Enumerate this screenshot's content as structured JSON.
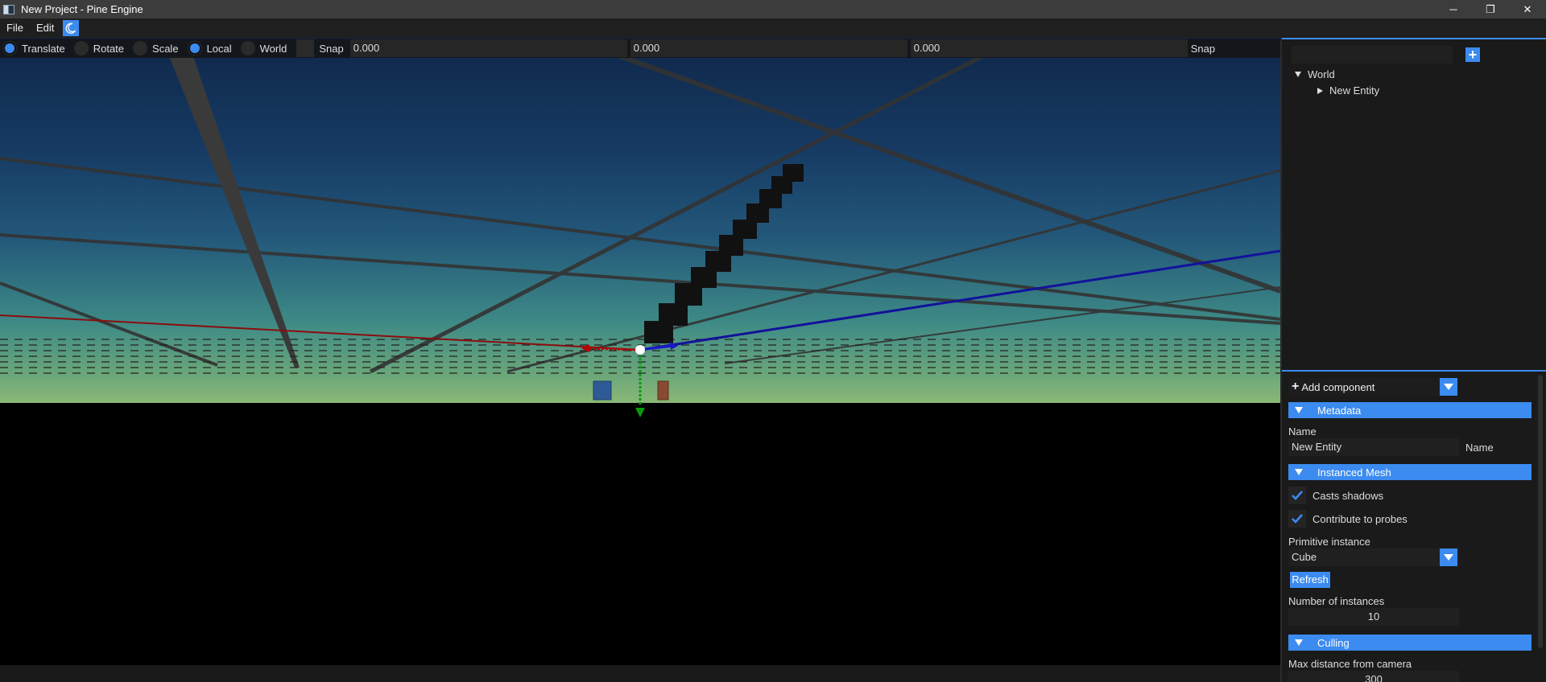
{
  "window": {
    "title": "New Project - Pine Engine",
    "minimize_glyph": "─",
    "maximize_glyph": "❐",
    "close_glyph": "✕"
  },
  "menu": {
    "items": [
      "File",
      "Edit"
    ],
    "theme_icon": "moon-icon"
  },
  "gizmo_toolbar": {
    "translate": "Translate",
    "rotate": "Rotate",
    "scale": "Scale",
    "local": "Local",
    "world": "World",
    "snap_label": "Snap",
    "snap_x": "0.000",
    "snap_y": "0.000",
    "snap_z": "0.000",
    "snap_label_2": "Snap",
    "selected_mode": "Translate",
    "selected_space": "Local"
  },
  "outliner": {
    "search_value": "",
    "add_icon": "plus-icon",
    "tree": [
      {
        "label": "World",
        "expanded": true
      },
      {
        "label": "New Entity",
        "expanded": false
      }
    ]
  },
  "inspector": {
    "add_component": "Add component",
    "metadata_header": "Metadata",
    "name_label": "Name",
    "name_value": "New Entity",
    "name_suffix": "Name",
    "instanced_mesh_header": "Instanced Mesh",
    "casts_shadows": "Casts shadows",
    "casts_shadows_checked": true,
    "contribute_probes": "Contribute to probes",
    "contribute_probes_checked": true,
    "primitive_label": "Primitive instance",
    "primitive_value": "Cube",
    "refresh": "Refresh",
    "instances_label": "Number of instances",
    "instances_value": "10",
    "culling_header": "Culling",
    "max_distance_label": "Max distance from camera",
    "max_distance_value": "300"
  },
  "colors": {
    "accent": "#3b8bf0",
    "panel": "#1a1a1a",
    "axis_x": "#9a0f0f",
    "axis_y": "#0a8a0a",
    "axis_z": "#1010a0"
  }
}
